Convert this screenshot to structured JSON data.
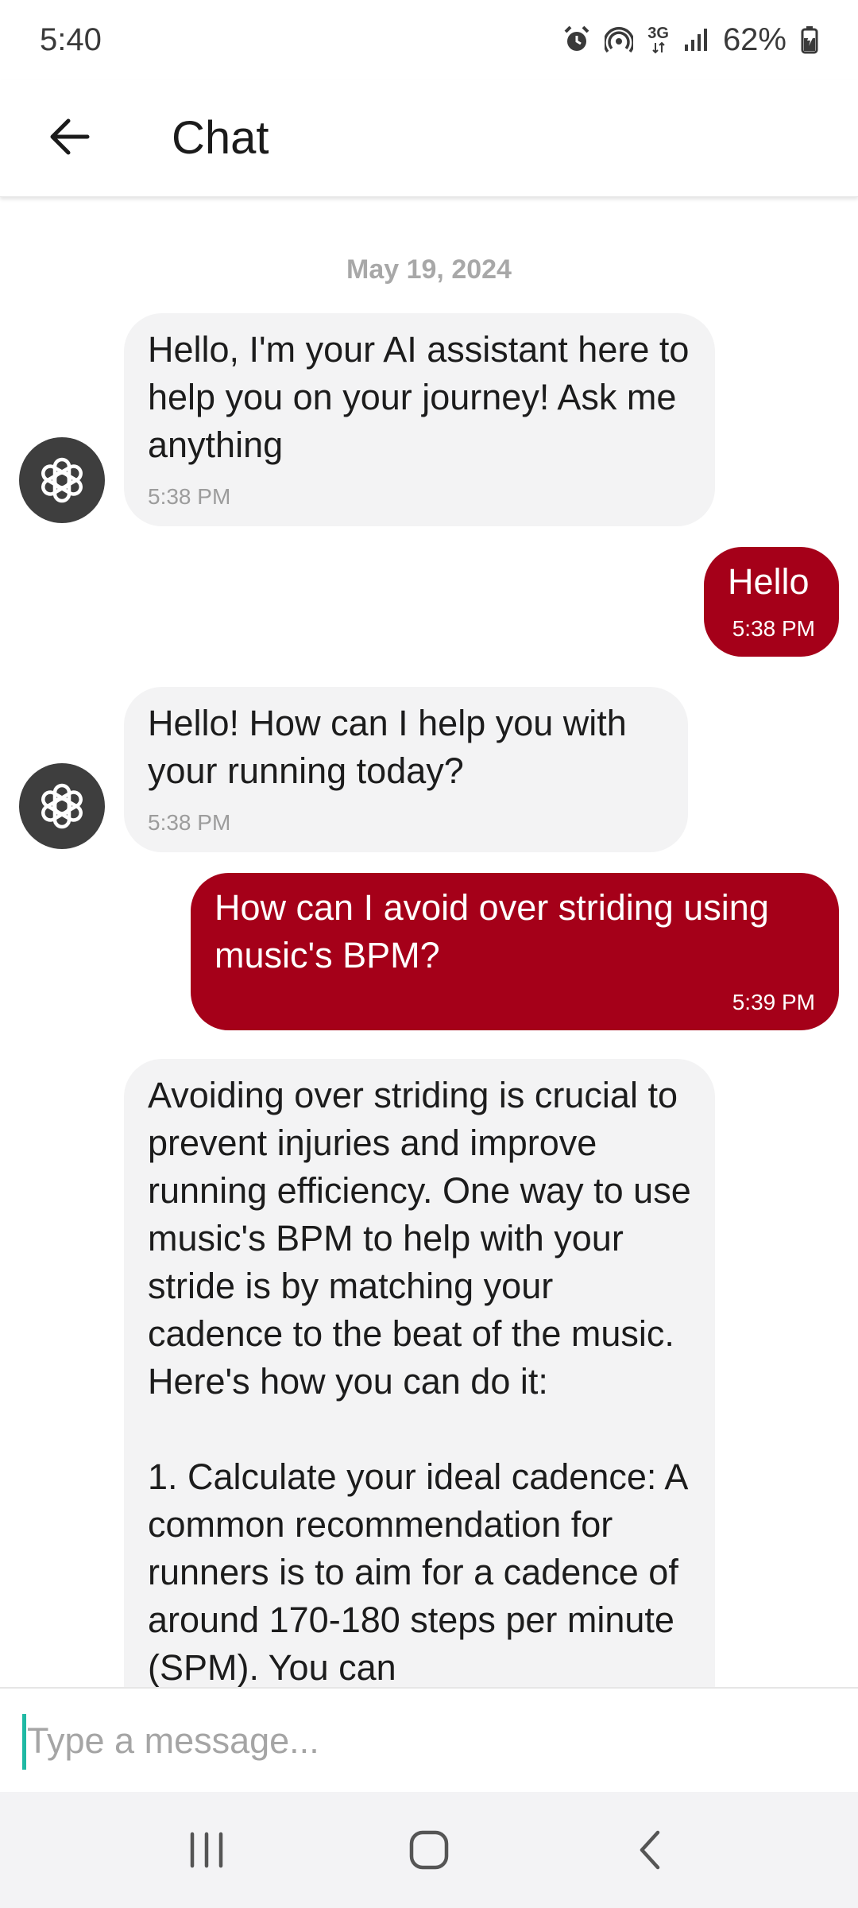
{
  "status_bar": {
    "time": "5:40",
    "network": "3G",
    "battery": "62%",
    "icons": [
      "alarm-icon",
      "hotspot-icon",
      "network-3g-icon",
      "signal-icon",
      "battery-icon"
    ]
  },
  "header": {
    "back_icon": "arrow-left-icon",
    "title": "Chat"
  },
  "chat": {
    "date": "May 19, 2024",
    "messages": [
      {
        "sender": "assistant",
        "text": "Hello, I'm your AI assistant here to help you on your journey! Ask me anything",
        "time": "5:38 PM"
      },
      {
        "sender": "user",
        "text": "Hello",
        "time": "5:38 PM"
      },
      {
        "sender": "assistant",
        "text": "Hello! How can I help you with your running today?",
        "time": "5:38 PM"
      },
      {
        "sender": "user",
        "text": "How can I avoid over striding using music's BPM?",
        "time": "5:39 PM"
      },
      {
        "sender": "assistant",
        "text": "Avoiding over striding is crucial to prevent injuries and improve running efficiency. One way to use music's BPM to help with your stride is by matching your cadence to the beat of the music. Here's how you can do it:\n\n1. Calculate your ideal cadence: A common recommendation for runners is to aim for a cadence of around 170-180 steps per minute (SPM). You can"
      }
    ]
  },
  "composer": {
    "placeholder": "Type a message..."
  },
  "nav": {
    "icons": [
      "recent-apps-icon",
      "home-icon",
      "back-icon"
    ]
  },
  "colors": {
    "user_bubble": "#a50019",
    "assistant_bubble": "#f3f3f4",
    "avatar": "#3e3e3e",
    "caret": "#1fb9a4"
  }
}
